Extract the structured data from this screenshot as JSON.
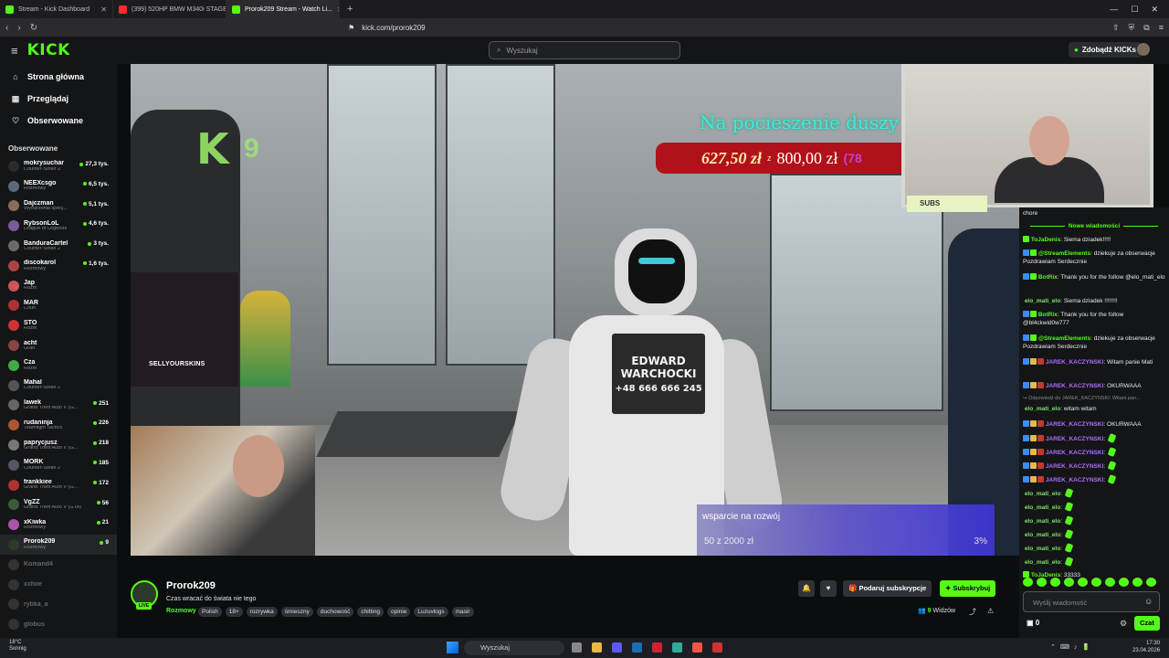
{
  "browser": {
    "tabs": [
      {
        "title": "Stream - Kick Dashboard",
        "color": "#53fc18"
      },
      {
        "title": "(399) 520HP BMW M340i STAGE 2 //",
        "color": "#ff2d2d"
      },
      {
        "title": "Prorok209 Stream - Watch Li...",
        "color": "#53fc18",
        "active": true
      }
    ],
    "url": "kick.com/prorok209"
  },
  "kick": {
    "logo": "KICK",
    "search_placeholder": "Wyszukaj",
    "get_kicks": "Zdobądź KICKs"
  },
  "sidebar": {
    "nav": [
      {
        "label": "Strona główna",
        "icon": "home-icon"
      },
      {
        "label": "Przeglądaj",
        "icon": "browse-icon"
      },
      {
        "label": "Obserwowane",
        "icon": "heart-icon"
      }
    ],
    "followed_title": "Obserwowane",
    "channels": [
      {
        "name": "mokrysuchar",
        "category": "Counter-Strike 2",
        "viewers": "27,3 tys.",
        "color": "#2b2b2b"
      },
      {
        "name": "NEEXcsgo",
        "category": "Rozmowy",
        "viewers": "6,5 tys.",
        "color": "#5a6a7a"
      },
      {
        "name": "Dajczman",
        "category": "Wydarzenia specj...",
        "viewers": "5,1 tys.",
        "color": "#8a6a5a"
      },
      {
        "name": "RybsonLoL",
        "category": "League of Legends",
        "viewers": "4,6 tys.",
        "color": "#7a5a9a"
      },
      {
        "name": "BanduraCartel",
        "category": "Counter-Strike 2",
        "viewers": "3 tys.",
        "color": "#6a6a6a"
      },
      {
        "name": "discokarol",
        "category": "Rozmowy",
        "viewers": "1,6 tys.",
        "color": "#aa4444"
      },
      {
        "name": "Jap",
        "category": "Rozm",
        "viewers": "",
        "color": "#cc5555"
      },
      {
        "name": "MAR",
        "category": "Coun",
        "viewers": "",
        "color": "#aa3333"
      },
      {
        "name": "STO",
        "category": "Rozm",
        "viewers": "",
        "color": "#cc3333"
      },
      {
        "name": "acht",
        "category": "Gran",
        "viewers": "",
        "color": "#884444"
      },
      {
        "name": "Cza",
        "category": "Rozm",
        "viewers": "",
        "color": "#44aa44"
      },
      {
        "name": "Mahal",
        "category": "Counter-Strike 2",
        "viewers": "",
        "color": "#555555"
      },
      {
        "name": "lawek",
        "category": "Grand Theft Auto V (G...",
        "viewers": "251",
        "color": "#666666"
      },
      {
        "name": "rudaninja",
        "category": "Teamfight Tactics",
        "viewers": "226",
        "color": "#aa5533"
      },
      {
        "name": "paprycjusz",
        "category": "Grand Theft Auto V (G...",
        "viewers": "218",
        "color": "#777777"
      },
      {
        "name": "MORK",
        "category": "Counter-Strike 2",
        "viewers": "185",
        "color": "#555566"
      },
      {
        "name": "frankkiee",
        "category": "Grand Theft Auto V (G...",
        "viewers": "172",
        "color": "#aa3333"
      },
      {
        "name": "VgZZ",
        "category": "Grand Theft Auto V (GTA)",
        "viewers": "56",
        "color": "#3a5a3a"
      },
      {
        "name": "xKiwka",
        "category": "Rozmowy",
        "viewers": "21",
        "color": "#aa55aa"
      },
      {
        "name": "Prorok209",
        "category": "Rozmowy",
        "viewers": "9",
        "color": "#2c3a2a",
        "active": true
      },
      {
        "name": "Komand4",
        "category": "",
        "viewers": "",
        "color": "#333333",
        "offline": true
      },
      {
        "name": "xxhiie",
        "category": "",
        "viewers": "",
        "color": "#333333",
        "offline": true
      },
      {
        "name": "rybka_a",
        "category": "",
        "viewers": "",
        "color": "#333333",
        "offline": true
      },
      {
        "name": "globus",
        "category": "",
        "viewers": "",
        "color": "#333333",
        "offline": true
      }
    ]
  },
  "video": {
    "goal_title": "Na pocieszenie duszy",
    "goal_current": "627,50 zł",
    "goal_sep": "z",
    "goal_total": "800,00 zł",
    "goal_pct": "(78",
    "sign_line1": "EDWARD",
    "sign_line2": "WARCHOCKI",
    "sign_line3": "+48 666 666 245",
    "overlay_num": "9",
    "ad_brand": "SELLYOURSKINS",
    "support_label": "wsparcie na rozwój",
    "support_amount": "50 z 2000 zł",
    "support_pct": "3%",
    "subs_tag": "SUBS"
  },
  "stream": {
    "streamer": "Prorok209",
    "title": "Czas wracać do świata nie tego",
    "category": "Rozmowy",
    "live": "LIVE",
    "tags": [
      "Polish",
      "18+",
      "rozrywka",
      "śmieszny",
      "duchowość",
      "chitting",
      "opinie",
      "Luzuvlogs",
      "masir"
    ],
    "gift_label": "Podaruj subskrypcje",
    "sub_label": "Subskrybuj",
    "viewers_count": "9",
    "viewers_label": "Widzów"
  },
  "chat": {
    "top_text": "chore",
    "new_messages": "Nowe wiadomości",
    "messages": [
      {
        "user": "ToJaDenis",
        "text": "Siema dziadek!!!!!",
        "cls": "u-green"
      },
      {
        "user": "@StreamElements",
        "text": "dziekuje za obserwacje Pozdrawiam Serdecznie",
        "cls": "u-green"
      },
      {
        "user": "BotRix",
        "text": "Thank you for the follow @elo_mati_elo",
        "cls": "u-green"
      },
      {
        "user": "elo_mati_elo",
        "text": "Siema dziadek !!!!!!!!",
        "cls": "u-lgreen"
      },
      {
        "user": "BotRix",
        "text": "Thank you for the follow @bl4ckwid0w777",
        "cls": "u-green"
      },
      {
        "user": "@StreamElements",
        "text": "dziekuje za obserwacje Pozdrawiam Serdecznie",
        "cls": "u-green"
      },
      {
        "user": "JAREK_KACZYNSKI",
        "text": "Witam panie Mati",
        "cls": "u-purple"
      },
      {
        "user": "JAREK_KACZYNSKI",
        "text": "OKURWAAA",
        "cls": "u-purple"
      },
      {
        "user": "",
        "text": "Odpowiedź do JAREK_KACZYNSKI: Witam pan...",
        "cls": "reply"
      },
      {
        "user": "elo_mati_elo",
        "text": "witam witam",
        "cls": "u-lgreen"
      },
      {
        "user": "JAREK_KACZYNSKI",
        "text": "OKURWAAA",
        "cls": "u-purple"
      },
      {
        "user": "JAREK_KACZYNSKI",
        "text": "",
        "cls": "u-purple",
        "emote": true
      },
      {
        "user": "JAREK_KACZYNSKI",
        "text": "",
        "cls": "u-purple",
        "emote": true
      },
      {
        "user": "JAREK_KACZYNSKI",
        "text": "",
        "cls": "u-purple",
        "emote": true
      },
      {
        "user": "JAREK_KACZYNSKI",
        "text": "",
        "cls": "u-purple",
        "emote": true
      },
      {
        "user": "elo_mati_elo",
        "text": "",
        "cls": "u-lgreen",
        "emote": true
      },
      {
        "user": "elo_mati_elo",
        "text": "",
        "cls": "u-lgreen",
        "emote": true
      },
      {
        "user": "elo_mati_elo",
        "text": "",
        "cls": "u-lgreen",
        "emote": true
      },
      {
        "user": "elo_mati_elo",
        "text": "",
        "cls": "u-lgreen",
        "emote": true
      },
      {
        "user": "elo_mati_elo",
        "text": "",
        "cls": "u-lgreen",
        "emote": true
      },
      {
        "user": "elo_mati_elo",
        "text": "",
        "cls": "u-lgreen",
        "emote": true
      },
      {
        "user": "ToJaDenis",
        "text": "33333",
        "cls": "u-green"
      }
    ],
    "input_placeholder": "Wyślij wiadomość",
    "footer_count": "0",
    "chat_button": "Czat"
  },
  "taskbar": {
    "temp": "18°C",
    "weather": "Sonnig",
    "search": "Wyszukaj",
    "time": "17:30",
    "date": "23.04.2026"
  }
}
